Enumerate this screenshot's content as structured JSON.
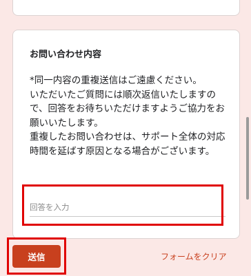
{
  "question": {
    "title": "お問い合わせ内容",
    "description": "*同一内容の重複送信はご遠慮ください。\nいただいたご質問には順次返信いたしますので、回答をお待ちいただけますようご協力をお願いいたします。\n重複したお問い合わせは、サポート全体の対応時間を延ばす原因となる場合がございます。",
    "answer_placeholder": "回答を入力",
    "answer_value": ""
  },
  "actions": {
    "submit_label": "送信",
    "clear_label": "フォームをクリア"
  },
  "colors": {
    "background": "#fbe8e6",
    "accent": "#c8401e",
    "highlight": "#e00000"
  }
}
